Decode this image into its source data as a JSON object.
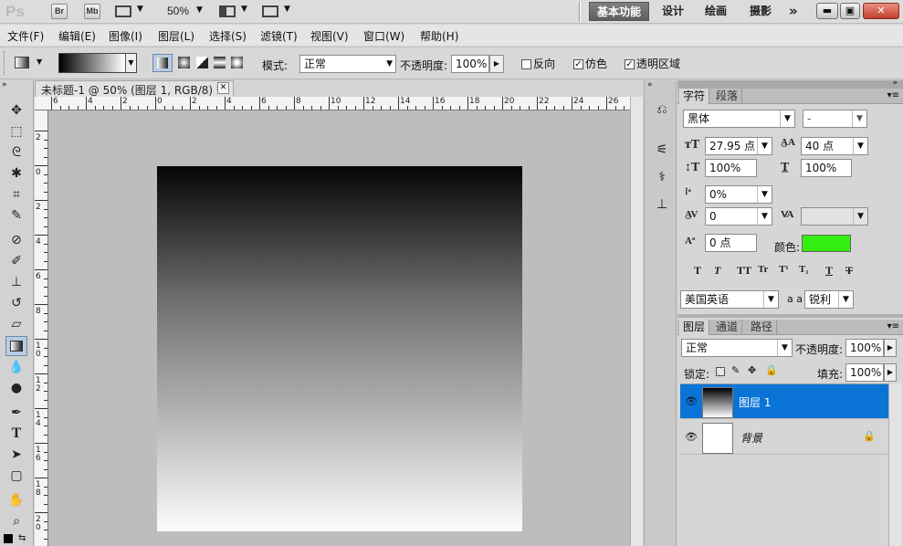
{
  "titlebar": {
    "logo": "Ps",
    "bridge": "Br",
    "minibridge": "Mb",
    "zoom": "50%",
    "workspaces": [
      "基本功能",
      "设计",
      "绘画",
      "摄影"
    ],
    "more": "»"
  },
  "menu": [
    "文件(F)",
    "编辑(E)",
    "图像(I)",
    "图层(L)",
    "选择(S)",
    "滤镜(T)",
    "视图(V)",
    "窗口(W)",
    "帮助(H)"
  ],
  "options": {
    "mode_label": "模式:",
    "mode_value": "正常",
    "opacity_label": "不透明度:",
    "opacity_value": "100%",
    "reverse": "反向",
    "dither": "仿色",
    "transparency": "透明区域"
  },
  "document": {
    "tab_title": "未标题-1 @ 50% (图层 1, RGB/8) *",
    "hruler_labels": [
      "6",
      "4",
      "2",
      "0",
      "2",
      "4",
      "6",
      "8",
      "10",
      "12",
      "14",
      "16",
      "18",
      "20",
      "22",
      "24",
      "26"
    ],
    "vruler_labels": [
      "2",
      "0",
      "2",
      "4",
      "6",
      "8",
      "1 0",
      "1 2",
      "1 4",
      "1 6",
      "1 8",
      "2 0"
    ]
  },
  "character": {
    "tabs": [
      "字符",
      "段落"
    ],
    "font_family": "黑体",
    "font_style": "-",
    "font_size": "27.95 点",
    "leading": "40 点",
    "vscale": "100%",
    "hscale": "100%",
    "tsume": "0%",
    "tracking": "0",
    "kerning": "",
    "baseline": "0 点",
    "color_label": "颜色:",
    "color": "#33ee11",
    "language": "美国英语",
    "antialias_label": "a a",
    "antialias": "锐利",
    "style_buttons": [
      "T",
      "T",
      "TT",
      "Tr",
      "T¹",
      "T₁",
      "T",
      "T"
    ]
  },
  "layers": {
    "tabs": [
      "图层",
      "通道",
      "路径"
    ],
    "blend_mode": "正常",
    "opacity_label": "不透明度:",
    "opacity": "100%",
    "lock_label": "锁定:",
    "fill_label": "填充:",
    "fill": "100%",
    "items": [
      {
        "name": "图层 1",
        "selected": true
      },
      {
        "name": "背景",
        "selected": false
      }
    ]
  }
}
